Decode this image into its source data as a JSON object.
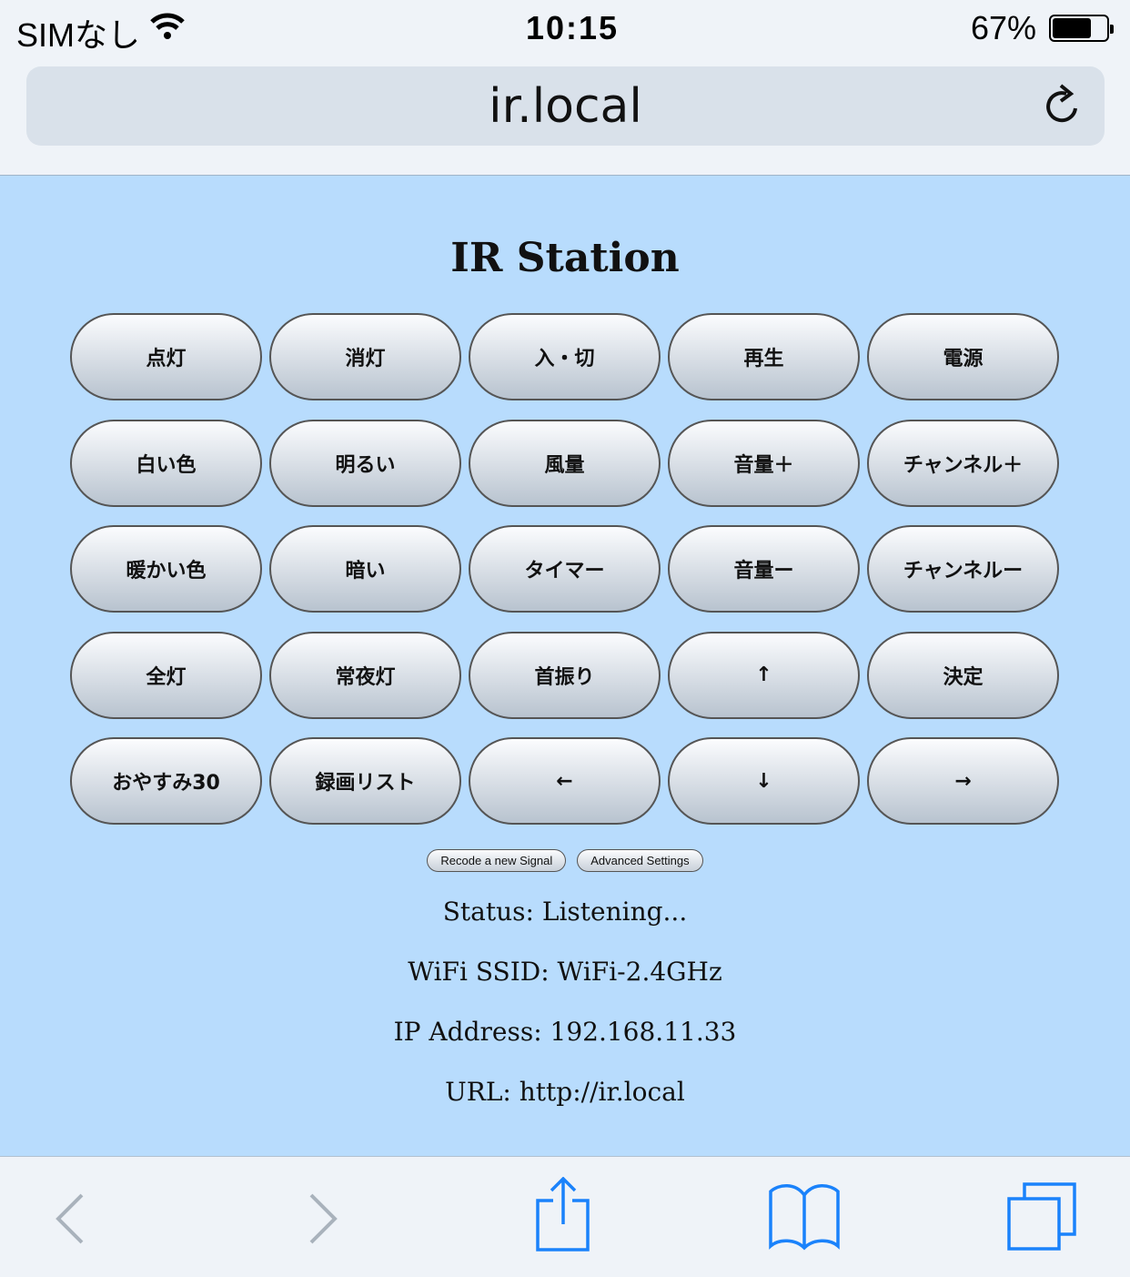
{
  "status_bar": {
    "carrier": "SIMなし",
    "time": "10:15",
    "battery": "67%",
    "battery_level": 0.67
  },
  "browser": {
    "url": "ir.local"
  },
  "page": {
    "title": "IR Station",
    "buttons": [
      "点灯",
      "消灯",
      "入・切",
      "再生",
      "電源",
      "白い色",
      "明るい",
      "風量",
      "音量＋",
      "チャンネル＋",
      "暖かい色",
      "暗い",
      "タイマー",
      "音量ー",
      "チャンネルー",
      "全灯",
      "常夜灯",
      "首振り",
      "↑",
      "決定",
      "おやすみ30",
      "録画リスト",
      "←",
      "↓",
      "→"
    ],
    "recode_label": "Recode a new Signal",
    "advanced_label": "Advanced Settings",
    "status": "Status: Listening...",
    "ssid": "WiFi SSID: WiFi-2.4GHz",
    "ip": "IP Address: 192.168.11.33",
    "url": "URL: http://ir.local"
  },
  "colors": {
    "background": "#b8dcfd",
    "accent": "#1a82fb"
  }
}
